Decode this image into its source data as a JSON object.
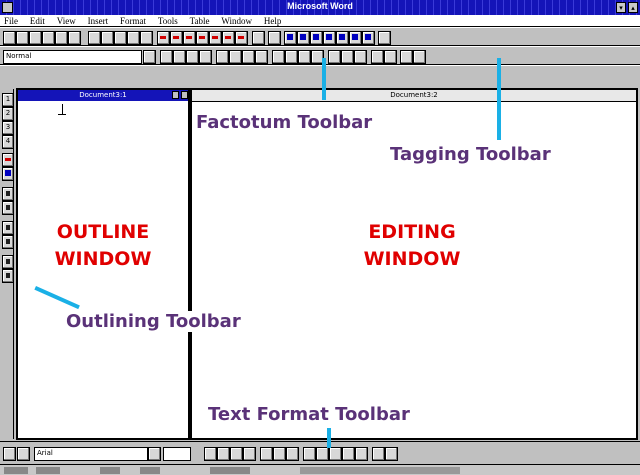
{
  "window": {
    "title": "Microsoft Word",
    "minimize_glyph": "▾",
    "maximize_glyph": "▴"
  },
  "menu": [
    "File",
    "Edit",
    "View",
    "Insert",
    "Format",
    "Tools",
    "Table",
    "Window",
    "Help"
  ],
  "format_bar": {
    "style_value": "Normal"
  },
  "text_format_bar": {
    "font_value": "Arial"
  },
  "outline_window": {
    "title": "Document3:1",
    "label_line1": "OUTLINE",
    "label_line2": "WINDOW"
  },
  "editing_window": {
    "title": "Document3:2",
    "label_line1": "EDITING",
    "label_line2": "WINDOW"
  },
  "outline_toolbar_buttons": [
    "1",
    "2",
    "3",
    "4"
  ],
  "callouts": {
    "factotum": "Factotum Toolbar",
    "tagging": "Tagging Toolbar",
    "outlining": "Outlining Toolbar",
    "text_format": "Text Format Toolbar"
  },
  "colors": {
    "titlebar": "#1414b8",
    "window_label": "#e00000",
    "callout_text": "#5a3278",
    "pointer": "#1ab0e6"
  },
  "icons": [
    "app-system-menu-icon",
    "new-document-icon",
    "open-icon",
    "save-icon",
    "print-icon",
    "red-arrow-icon",
    "blue-arrow-icon"
  ]
}
